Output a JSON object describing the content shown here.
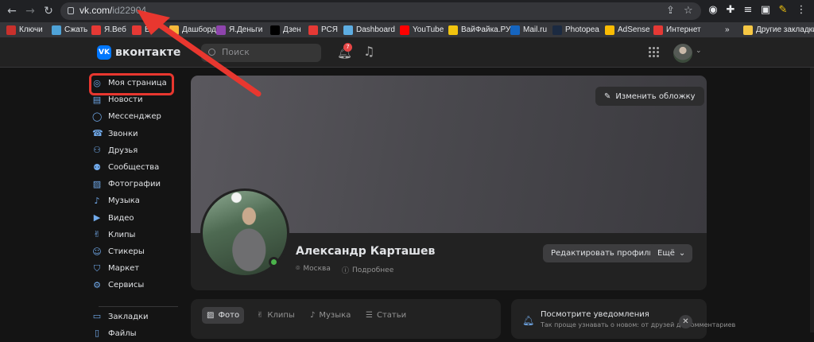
{
  "browser": {
    "url_host": "vk.com/",
    "url_path": "id22904",
    "bookmarks": [
      {
        "label": "Ключи",
        "color": "#c9302c"
      },
      {
        "label": "Сжать",
        "color": "#4fa3d8"
      },
      {
        "label": "Я.Веб",
        "color": "#e53935"
      },
      {
        "label": "В",
        "color": "#e53935"
      },
      {
        "label": "Дашборд",
        "color": "#f6b93b"
      },
      {
        "label": "Я.Деньги",
        "color": "#8e44ad"
      },
      {
        "label": "Дзен",
        "color": "#000000"
      },
      {
        "label": "РСЯ",
        "color": "#e53935"
      },
      {
        "label": "Dashboard",
        "color": "#5dade2"
      },
      {
        "label": "YouTube",
        "color": "#ff0000"
      },
      {
        "label": "ВайФайка.РУ",
        "color": "#f1c40f"
      },
      {
        "label": "Mail.ru",
        "color": "#1565c0"
      },
      {
        "label": "Photopea",
        "color": "#1b2a41"
      },
      {
        "label": "AdSense",
        "color": "#fbbc04"
      },
      {
        "label": "Интернет",
        "color": "#e53935"
      }
    ],
    "bookmarks_more": "»",
    "other_bookmarks": "Другие закладки"
  },
  "header": {
    "logo_text": "вконтакте",
    "logo_mark": "VK",
    "search_placeholder": "Поиск",
    "notifications_count": "7"
  },
  "sidebar": {
    "items": [
      {
        "label": "Моя страница",
        "icon": "user-circle-icon"
      },
      {
        "label": "Новости",
        "icon": "news-icon"
      },
      {
        "label": "Мессенджер",
        "icon": "message-icon"
      },
      {
        "label": "Звонки",
        "icon": "phone-icon"
      },
      {
        "label": "Друзья",
        "icon": "friends-icon"
      },
      {
        "label": "Сообщества",
        "icon": "communities-icon"
      },
      {
        "label": "Фотографии",
        "icon": "photo-icon"
      },
      {
        "label": "Музыка",
        "icon": "music-icon"
      },
      {
        "label": "Видео",
        "icon": "video-icon"
      },
      {
        "label": "Клипы",
        "icon": "clips-icon"
      },
      {
        "label": "Стикеры",
        "icon": "sticker-icon"
      },
      {
        "label": "Маркет",
        "icon": "market-icon"
      },
      {
        "label": "Сервисы",
        "icon": "services-icon"
      },
      {
        "label": "Закладки",
        "icon": "bookmark-icon"
      },
      {
        "label": "Файлы",
        "icon": "file-icon"
      }
    ]
  },
  "profile": {
    "edit_cover_label": "Изменить обложку",
    "name": "Александр Карташев",
    "city": "Москва",
    "details": "Подробнее",
    "edit_profile_label": "Редактировать профиль",
    "more_label": "Ещё"
  },
  "content_tabs": [
    {
      "label": "Фото",
      "active": true
    },
    {
      "label": "Клипы",
      "active": false
    },
    {
      "label": "Музыка",
      "active": false
    },
    {
      "label": "Статьи",
      "active": false
    }
  ],
  "notification_card": {
    "title": "Посмотрите уведомления",
    "subtitle": "Так проще узнавать о новом: от друзей до комментариев"
  },
  "annotation": {
    "arrow_color": "#e8372f"
  }
}
